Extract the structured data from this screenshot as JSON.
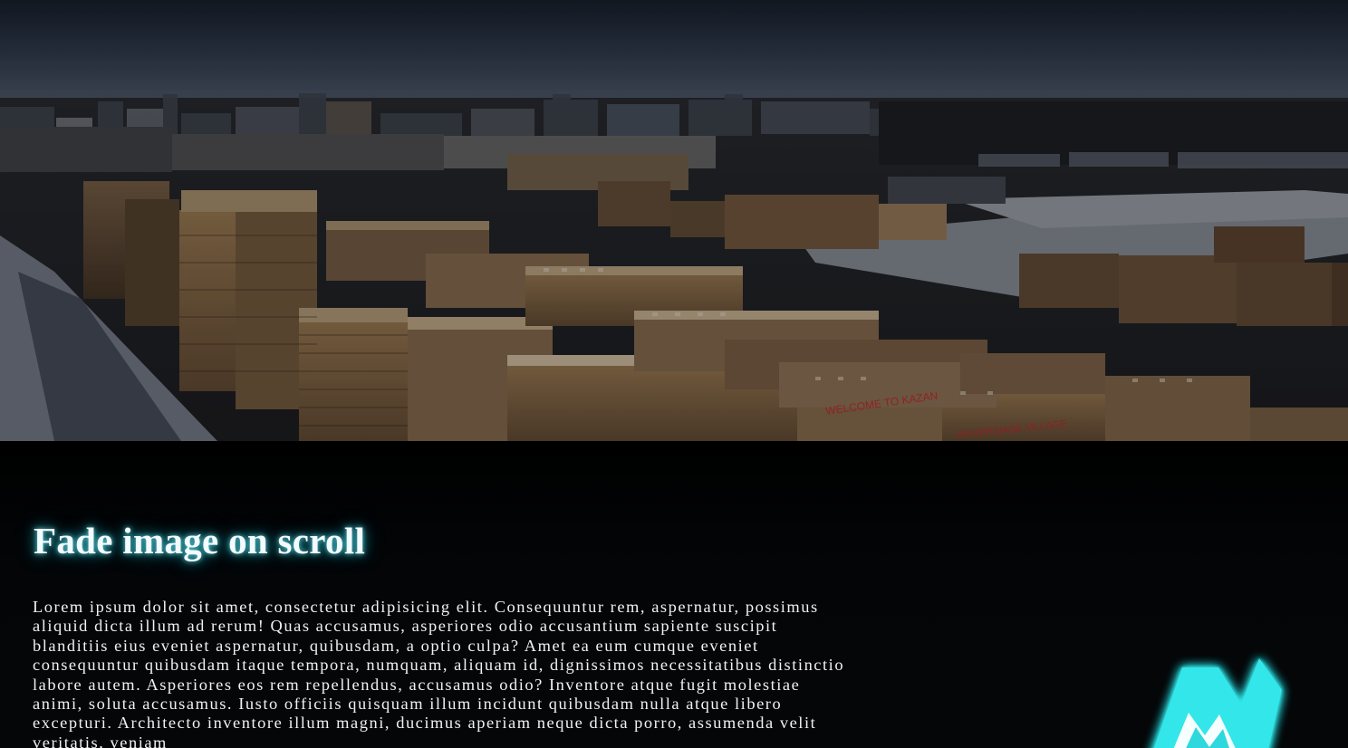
{
  "hero": {
    "sign_text_1": "WELCOME TO KAZAN",
    "sign_text_2": "UNIVERSIADE VILLAGE"
  },
  "article": {
    "title": "Fade image on scroll",
    "body": "Lorem ipsum dolor sit amet, consectetur adipisicing elit. Consequuntur rem, aspernatur, possimus aliquid dicta illum ad rerum! Quas accusamus, asperiores odio accusantium sapiente suscipit blanditiis eius eveniet aspernatur, quibusdam, a optio culpa? Amet ea eum cumque eveniet consequuntur quibusdam itaque tempora, numquam, aliquam id, dignissimos necessitatibus distinctio labore autem. Asperiores eos rem repellendus, accusamus odio? Inventore atque fugit molestiae animi, soluta accusamus. Iusto officiis quisquam illum incidunt quibusdam nulla atque libero excepturi. Architecto inventore illum magni, ducimus aperiam neque dicta porro, assumenda velit veritatis, veniam"
  },
  "logo": {
    "icon": "neon-mountain-logo-icon",
    "glow_color": "#2fe3e6"
  }
}
